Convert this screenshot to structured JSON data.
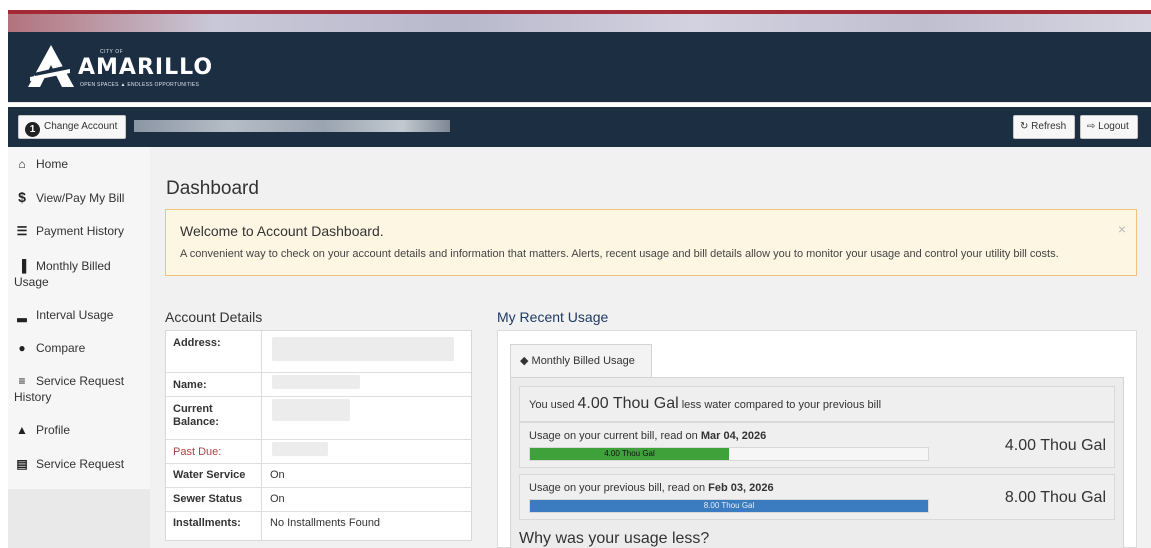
{
  "brand": {
    "city_of": "CITY OF",
    "name": "AMARILLO",
    "tagline": "OPEN SPACES ▲ ENDLESS OPPORTUNITIES"
  },
  "account_bar": {
    "change_account_number": "1",
    "change_account_label": "Change Account",
    "refresh_label": "Refresh",
    "logout_label": "Logout"
  },
  "sidebar": {
    "items": [
      {
        "label": "Home",
        "icon": "home-icon"
      },
      {
        "label": "View/Pay My Bill",
        "icon": "dollar-icon"
      },
      {
        "label": "Payment History",
        "icon": "list-icon"
      },
      {
        "label": "Monthly Billed Usage",
        "icon": "bar-chart-icon"
      },
      {
        "label": "Interval Usage",
        "icon": "signal-icon"
      },
      {
        "label": "Compare",
        "icon": "users-icon"
      },
      {
        "label": "Service Request History",
        "icon": "tasks-icon"
      },
      {
        "label": "Profile",
        "icon": "user-icon"
      },
      {
        "label": "Service Request",
        "icon": "file-icon"
      }
    ]
  },
  "main": {
    "title": "Dashboard",
    "alert": {
      "title": "Welcome to Account Dashboard.",
      "text": "A convenient way to check on your account details and information that matters. Alerts, recent usage and bill details allow you to monitor your usage and control your utility bill costs.",
      "close": "×"
    },
    "account_details": {
      "title": "Account Details",
      "rows": [
        {
          "label": "Address:",
          "value": ""
        },
        {
          "label": "Name:",
          "value": ""
        },
        {
          "label": "Current Balance:",
          "value": ""
        },
        {
          "label": "Past Due:",
          "value": ""
        },
        {
          "label": "Water Service",
          "value": "On"
        },
        {
          "label": "Sewer Status",
          "value": "On"
        },
        {
          "label": "Installments:",
          "value": "No Installments Found"
        }
      ],
      "past_due_color": "#a94442"
    },
    "recent_usage": {
      "title": "My Recent Usage",
      "tab_label": "Monthly Billed Usage",
      "summary_prefix": "You used ",
      "summary_amount": "4.00 Thou Gal",
      "summary_suffix": " less water compared to your previous bill",
      "current": {
        "label_prefix": "Usage on your current bill, read on ",
        "date": "Mar 04, 2026",
        "bar_text": "4.00 Thou Gal",
        "value": "4.00 Thou Gal",
        "fraction": 0.5
      },
      "previous": {
        "label_prefix": "Usage on your previous bill, read on ",
        "date": "Feb 03, 2026",
        "bar_text": "8.00 Thou Gal",
        "value": "8.00 Thou Gal",
        "fraction": 1.0
      },
      "why_heading": "Why was your usage less?"
    }
  },
  "colors": {
    "header_navy": "#1c2e42",
    "current_bar": "#3ea13a",
    "previous_bar": "#3b7bbf",
    "alert_border": "#f0c27b"
  }
}
